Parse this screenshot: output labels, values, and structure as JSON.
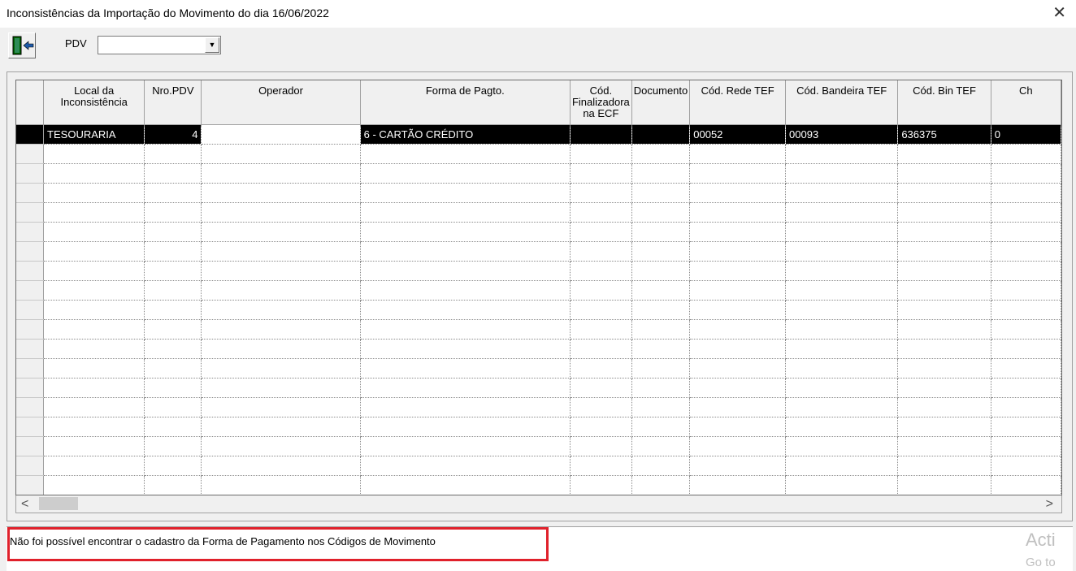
{
  "window": {
    "title": "Inconsistências da Importação do Movimento do dia 16/06/2022",
    "close_glyph": "✕"
  },
  "toolbar": {
    "exit_icon": "exit-door-icon",
    "pdv_label": "PDV",
    "pdv_value": "",
    "dropdown_glyph": "▼"
  },
  "grid": {
    "columns": [
      "Local da Inconsistência",
      "Nro.PDV",
      "Operador",
      "Forma de Pagto.",
      "Cód. Finalizadora na ECF",
      "Documento",
      "Cód. Rede TEF",
      "Cód. Bandeira TEF",
      "Cód. Bin TEF",
      "Ch"
    ],
    "rows": [
      [
        "TESOURARIA",
        "4",
        "",
        "6 - CARTÃO CRÉDITO",
        "",
        "",
        "00052",
        "00093",
        "636375",
        "0"
      ]
    ],
    "empty_rows": 18
  },
  "scrollbar": {
    "left_glyph": "<",
    "right_glyph": ">"
  },
  "status": {
    "message": "Não foi possível encontrar o cadastro da Forma de Pagamento nos Códigos de Movimento",
    "highlight_color": "#e0212b"
  },
  "watermark": {
    "line1": "Acti",
    "line2": "Go to"
  }
}
